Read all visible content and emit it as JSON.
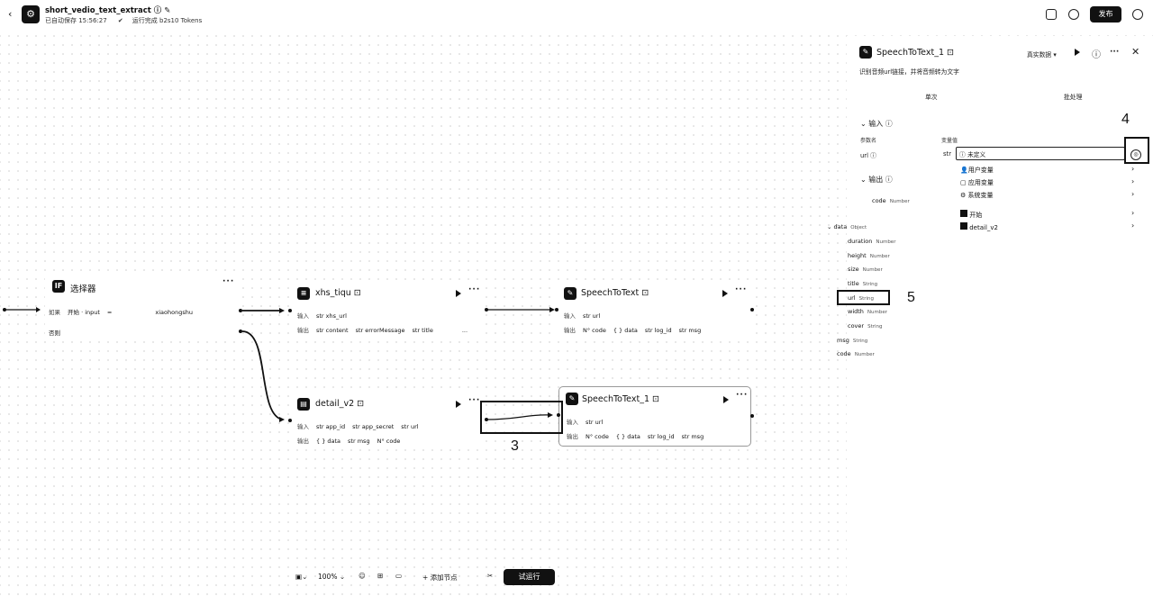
{
  "app": {
    "title": "short_vedio_text_extract",
    "autosave": "已自动保存 15:56:27",
    "run_status": "运行完成 b2s10 Tokens",
    "publish_label": "发布"
  },
  "nodes": {
    "selector": {
      "title": "选择器",
      "if_label": "如果",
      "cond_var": "开始 · input",
      "cond_op": "=",
      "cond_val": "xiaohongshu",
      "else_label": "否则"
    },
    "xhs": {
      "title": "xhs_tiqu",
      "in_label": "输入",
      "in_fields": [
        "str xhs_url"
      ],
      "out_label": "输出",
      "out_fields": [
        "str content",
        "str errorMessage",
        "str title",
        "..."
      ]
    },
    "detail": {
      "title": "detail_v2",
      "in_label": "输入",
      "in_fields": [
        "str app_id",
        "str app_secret",
        "str url"
      ],
      "out_label": "输出",
      "out_fields": [
        "{ } data",
        "str msg",
        "N° code"
      ]
    },
    "stt": {
      "title": "SpeechToText",
      "in_label": "输入",
      "in_fields": [
        "str url"
      ],
      "out_label": "输出",
      "out_fields": [
        "N° code",
        "{ } data",
        "str log_id",
        "str msg"
      ]
    },
    "stt1": {
      "title": "SpeechToText_1",
      "in_label": "输入",
      "in_fields": [
        "str url"
      ],
      "out_label": "输出",
      "out_fields": [
        "N° code",
        "{ } data",
        "str log_id",
        "str msg"
      ]
    }
  },
  "annotations": {
    "n3": "3",
    "n4": "4",
    "n5": "5"
  },
  "panel": {
    "title": "SpeechToText_1",
    "mock_label": "真实数据",
    "description": "识别音频url链接，并将音频转为文字",
    "tab_single": "单次",
    "tab_batch": "批处理",
    "input_heading": "输入",
    "col_param": "参数名",
    "col_value": "变量值",
    "param_name": "url",
    "param_type": "str",
    "input_placeholder": "未定义",
    "output_heading": "输出",
    "menu": [
      "用户变量",
      "应用变量",
      "系统变量",
      "开始",
      "detail_v2"
    ],
    "outputs": [
      {
        "name": "code",
        "type": "Number"
      },
      {
        "name": "data",
        "type": "Object"
      },
      {
        "name": "duration",
        "type": "Number"
      },
      {
        "name": "height",
        "type": "Number"
      },
      {
        "name": "size",
        "type": "Number"
      },
      {
        "name": "title",
        "type": "String"
      },
      {
        "name": "url",
        "type": "String"
      },
      {
        "name": "width",
        "type": "Number"
      },
      {
        "name": "cover",
        "type": "String"
      },
      {
        "name": "msg",
        "type": "String"
      },
      {
        "name": "code",
        "type": "Number"
      }
    ]
  },
  "toolbar": {
    "zoom": "100%",
    "add_node": "添加节点",
    "test_run": "试运行"
  }
}
